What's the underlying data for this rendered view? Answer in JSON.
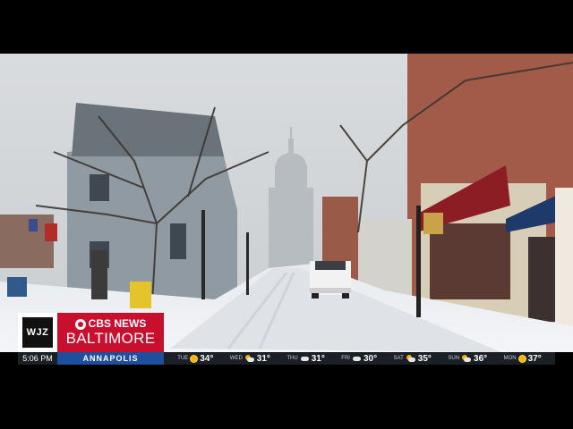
{
  "station": {
    "logo": "WJZ",
    "network": "CBS NEWS",
    "city": "BALTIMORE"
  },
  "ticker": {
    "time": "5:06 PM",
    "location": "ANNAPOLIS",
    "forecast": [
      {
        "day": "TUE",
        "icon": "sun-icon",
        "temp": "34°"
      },
      {
        "day": "WED",
        "icon": "partly-cloudy-icon",
        "temp": "31°"
      },
      {
        "day": "THU",
        "icon": "cloud-icon",
        "temp": "31°"
      },
      {
        "day": "FRI",
        "icon": "cloud-icon",
        "temp": "30°"
      },
      {
        "day": "SAT",
        "icon": "partly-cloudy-icon",
        "temp": "35°"
      },
      {
        "day": "SUN",
        "icon": "partly-cloudy-icon",
        "temp": "36°"
      },
      {
        "day": "MON",
        "icon": "sun-icon",
        "temp": "37°"
      }
    ]
  },
  "colors": {
    "brand_red": "#c8102e",
    "ticker_blue": "#1f4e9c",
    "ticker_bg": "#1b1f26"
  }
}
